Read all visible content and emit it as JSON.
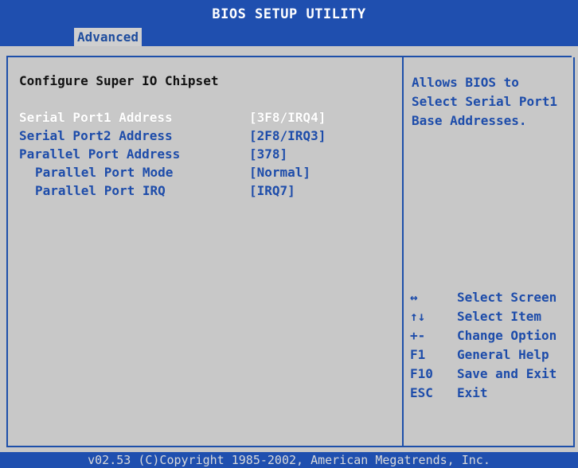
{
  "app": {
    "title": "BIOS SETUP UTILITY"
  },
  "tabs": [
    {
      "label": "Advanced",
      "active": true
    }
  ],
  "page": {
    "title": "Configure Super IO Chipset"
  },
  "settings": [
    {
      "label": "Serial Port1 Address",
      "value": "[3F8/IRQ4]",
      "selected": true
    },
    {
      "label": "Serial Port2 Address",
      "value": "[2F8/IRQ3]",
      "selected": false
    },
    {
      "label": "Parallel Port Address",
      "value": "[378]",
      "selected": false
    },
    {
      "label": "Parallel Port Mode",
      "value": "[Normal]",
      "selected": false
    },
    {
      "label": "Parallel Port IRQ",
      "value": "[IRQ7]",
      "selected": false
    }
  ],
  "help": {
    "text": "Allows BIOS to Select Serial Port1 Base Addresses."
  },
  "keys": [
    {
      "key": "↔",
      "action": "Select Screen"
    },
    {
      "key": "↑↓",
      "action": "Select Item"
    },
    {
      "key": "+-",
      "action": "Change Option"
    },
    {
      "key": "F1",
      "action": "General Help"
    },
    {
      "key": "F10",
      "action": "Save and Exit"
    },
    {
      "key": "ESC",
      "action": "Exit"
    }
  ],
  "footer": {
    "text": "v02.53 (C)Copyright 1985-2002, American Megatrends, Inc."
  },
  "colors": {
    "bar": "#1f4faf",
    "background": "#c8c8c8",
    "text": "#1d4caa",
    "selected": "#ffffff"
  }
}
